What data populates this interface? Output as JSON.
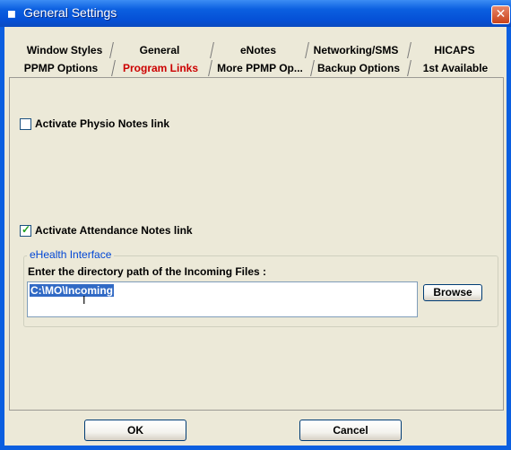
{
  "window": {
    "title": "General Settings",
    "title_icon": "app-icon",
    "close_label": "✕"
  },
  "tabs": {
    "row1": [
      {
        "label": "Window Styles"
      },
      {
        "label": "General"
      },
      {
        "label": "eNotes"
      },
      {
        "label": "Networking/SMS"
      },
      {
        "label": "HICAPS"
      }
    ],
    "row2": [
      {
        "label": "PPMP Options"
      },
      {
        "label": "Program Links",
        "active": true
      },
      {
        "label": "More PPMP Op..."
      },
      {
        "label": "Backup Options"
      },
      {
        "label": "1st Available"
      }
    ]
  },
  "program_links": {
    "physio_notes": {
      "label": "Activate Physio Notes link",
      "checked": false
    },
    "attendance_notes": {
      "label": "Activate Attendance Notes link",
      "checked": true
    }
  },
  "ehealth": {
    "group_title": "eHealth Interface",
    "description": "Enter the directory path of the Incoming Files :",
    "path_value": "C:\\MO\\Incoming",
    "browse_label": "Browse"
  },
  "buttons": {
    "ok_label": "OK",
    "cancel_label": "Cancel"
  },
  "colors": {
    "titlebar": "#0b5fe0",
    "active_tab_text": "#cc0000",
    "selection": "#316ac5",
    "group_title": "#0046d5"
  }
}
